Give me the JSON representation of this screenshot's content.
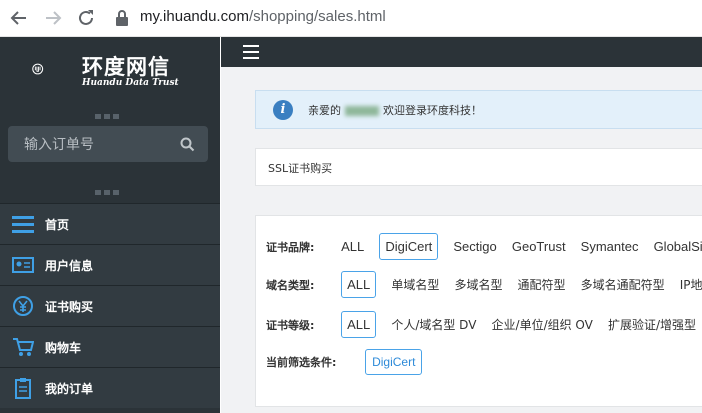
{
  "browser": {
    "url_domain": "my.ihuandu.com",
    "url_path": "/shopping/sales.html"
  },
  "brand": {
    "name": "环度网信",
    "subtitle": "Huandu Data Trust"
  },
  "sidebar": {
    "search_placeholder": "输入订单号",
    "items": [
      {
        "label": "首页",
        "icon": "menu-icon"
      },
      {
        "label": "用户信息",
        "icon": "id-card-icon"
      },
      {
        "label": "证书购买",
        "icon": "yen-coin-icon"
      },
      {
        "label": "购物车",
        "icon": "cart-icon"
      },
      {
        "label": "我的订单",
        "icon": "clipboard-icon"
      }
    ]
  },
  "notice": {
    "greeting": "亲爱的",
    "welcome": "欢迎登录环度科技！"
  },
  "panel": {
    "title": "SSL证书购买"
  },
  "filters": {
    "brand_label": "证书品牌:",
    "brand_options": [
      "ALL",
      "DigiCert",
      "Sectigo",
      "GeoTrust",
      "Symantec",
      "GlobalSign"
    ],
    "brand_selected": "DigiCert",
    "domain_label": "域名类型:",
    "domain_options": [
      "ALL",
      "单域名型",
      "多域名型",
      "通配符型",
      "多域名通配符型",
      "IP地址"
    ],
    "domain_selected": "ALL",
    "level_label": "证书等级:",
    "level_options": [
      "ALL",
      "个人/域名型 DV",
      "企业/单位/组织 OV",
      "扩展验证/增强型"
    ],
    "level_selected": "ALL",
    "current_label": "当前筛选条件:",
    "current_chip": "DigiCert"
  },
  "colors": {
    "sidebar_bg": "#2b3338",
    "accent": "#4aa3e8",
    "info_blue": "#3a7fc1"
  }
}
